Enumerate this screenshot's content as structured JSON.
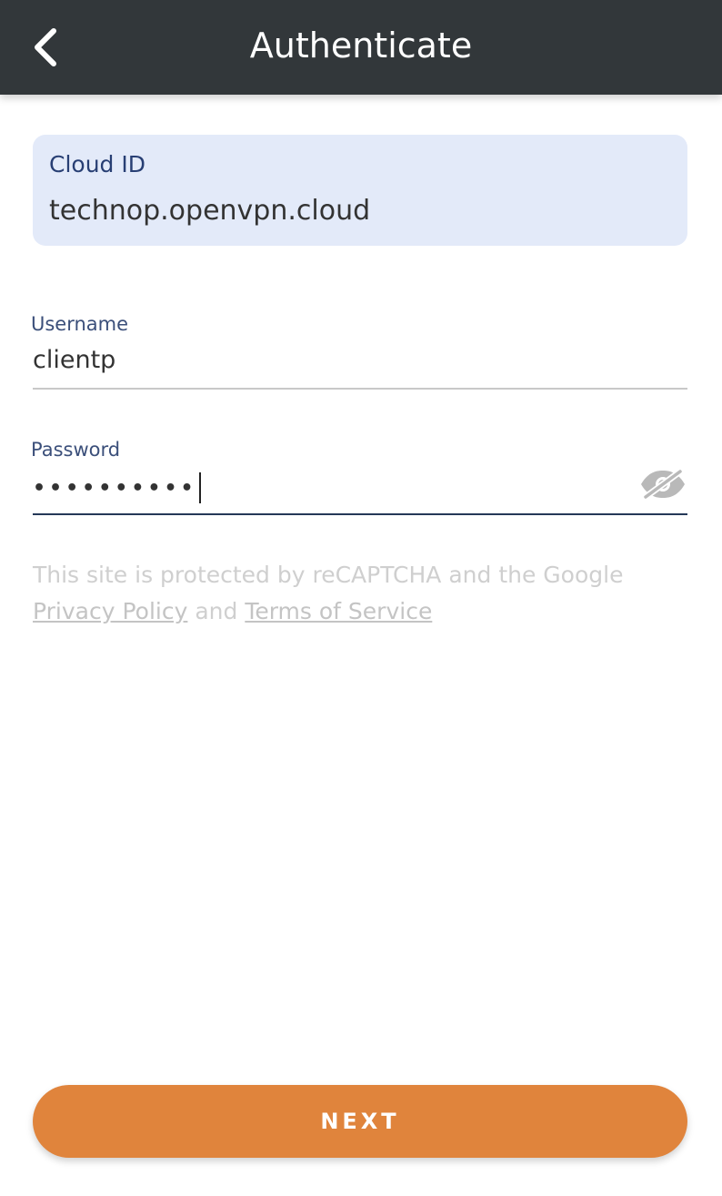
{
  "header": {
    "title": "Authenticate",
    "back_icon": "chevron-left-icon"
  },
  "cloud": {
    "label": "Cloud ID",
    "value": "technop.openvpn.cloud"
  },
  "username": {
    "label": "Username",
    "value": "clientp"
  },
  "password": {
    "label": "Password",
    "masked_value": "••••••••••",
    "toggle_icon": "eye-off-icon"
  },
  "recaptcha": {
    "text_before": "This site is protected by reCAPTCHA and the Google ",
    "privacy_link": "Privacy Policy",
    "text_middle": " and ",
    "terms_link": "Terms of Service"
  },
  "actions": {
    "next_label": "NEXT"
  },
  "colors": {
    "header_bg": "#32373a",
    "cloud_box_bg": "#e3eaf9",
    "label_color": "#3b4f7a",
    "accent_button": "#e0843c",
    "active_underline": "#253858"
  }
}
